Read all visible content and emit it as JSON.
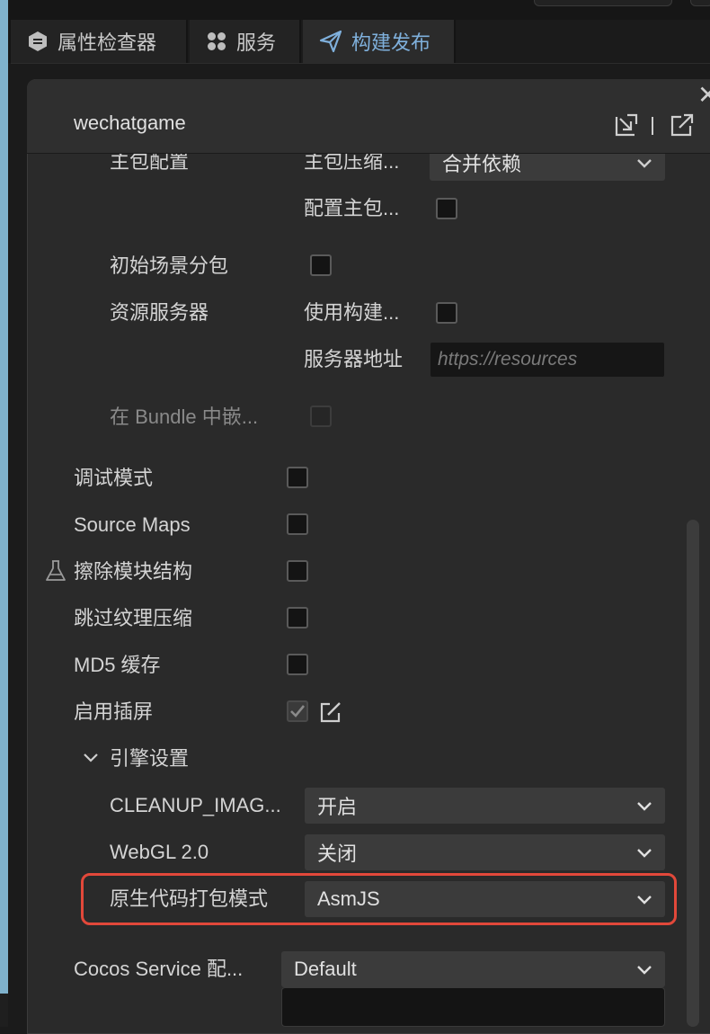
{
  "tabs": [
    {
      "label": "属性检查器",
      "icon": "inspector-icon"
    },
    {
      "label": "服务",
      "icon": "grid-icon"
    },
    {
      "label": "构建发布",
      "icon": "send-icon"
    }
  ],
  "panel": {
    "title": "wechatgame",
    "close_glyph": "✕"
  },
  "rows": {
    "cut_main_label": "主包配置",
    "cut_sub_label": "主包压缩...",
    "cut_select_value": "合并依赖",
    "config_main_label": "配置主包...",
    "initial_scene_label": "初始场景分包",
    "resource_server_label": "资源服务器",
    "use_build_label": "使用构建...",
    "server_address_label": "服务器地址",
    "server_address_placeholder": "https://resources",
    "bundle_embed_label": "在 Bundle 中嵌...",
    "debug_label": "调试模式",
    "source_maps_label": "Source Maps",
    "erase_module_label": "擦除模块结构",
    "skip_texture_label": "跳过纹理压缩",
    "md5_label": "MD5 缓存",
    "splash_label": "启用插屏",
    "engine_settings_label": "引擎设置",
    "cleanup_label": "CLEANUP_IMAG...",
    "cleanup_value": "开启",
    "webgl_label": "WebGL 2.0",
    "webgl_value": "关闭",
    "native_pack_label": "原生代码打包模式",
    "native_pack_value": "AsmJS",
    "cocos_service_label": "Cocos Service 配...",
    "cocos_service_value": "Default"
  },
  "checkboxes": {
    "config_main": false,
    "initial_scene": false,
    "use_build": false,
    "bundle_embed": false,
    "debug": false,
    "source_maps": false,
    "erase_module": false,
    "skip_texture": false,
    "md5": false,
    "splash": true
  },
  "colors": {
    "accent": "#7fb0dc",
    "highlight": "#e2483a"
  }
}
